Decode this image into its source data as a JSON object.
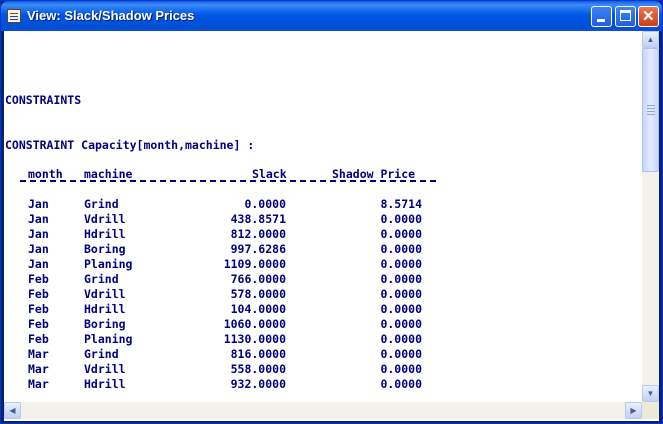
{
  "window": {
    "title": "View: Slack/Shadow Prices",
    "icon": "document-view-icon"
  },
  "report": {
    "section_title": "CONSTRAINTS",
    "constraint_title": "CONSTRAINT Capacity[month,machine] :",
    "headers": {
      "month": "month",
      "machine": "machine",
      "slack": "Slack",
      "shadow_price": "Shadow Price"
    },
    "rows": [
      {
        "month": "Jan",
        "machine": "Grind",
        "slack": "0.0000",
        "price": "8.5714"
      },
      {
        "month": "Jan",
        "machine": "Vdrill",
        "slack": "438.8571",
        "price": "0.0000"
      },
      {
        "month": "Jan",
        "machine": "Hdrill",
        "slack": "812.0000",
        "price": "0.0000"
      },
      {
        "month": "Jan",
        "machine": "Boring",
        "slack": "997.6286",
        "price": "0.0000"
      },
      {
        "month": "Jan",
        "machine": "Planing",
        "slack": "1109.0000",
        "price": "0.0000"
      },
      {
        "month": "Feb",
        "machine": "Grind",
        "slack": "766.0000",
        "price": "0.0000"
      },
      {
        "month": "Feb",
        "machine": "Vdrill",
        "slack": "578.0000",
        "price": "0.0000"
      },
      {
        "month": "Feb",
        "machine": "Hdrill",
        "slack": "104.0000",
        "price": "0.0000"
      },
      {
        "month": "Feb",
        "machine": "Boring",
        "slack": "1060.0000",
        "price": "0.0000"
      },
      {
        "month": "Feb",
        "machine": "Planing",
        "slack": "1130.0000",
        "price": "0.0000"
      },
      {
        "month": "Mar",
        "machine": "Grind",
        "slack": "816.0000",
        "price": "0.0000"
      },
      {
        "month": "Mar",
        "machine": "Vdrill",
        "slack": "558.0000",
        "price": "0.0000"
      },
      {
        "month": "Mar",
        "machine": "Hdrill",
        "slack": "932.0000",
        "price": "0.0000"
      }
    ]
  },
  "colors": {
    "text": "#000080",
    "titlebar": "#0058E6",
    "close_button": "#C8401A"
  }
}
